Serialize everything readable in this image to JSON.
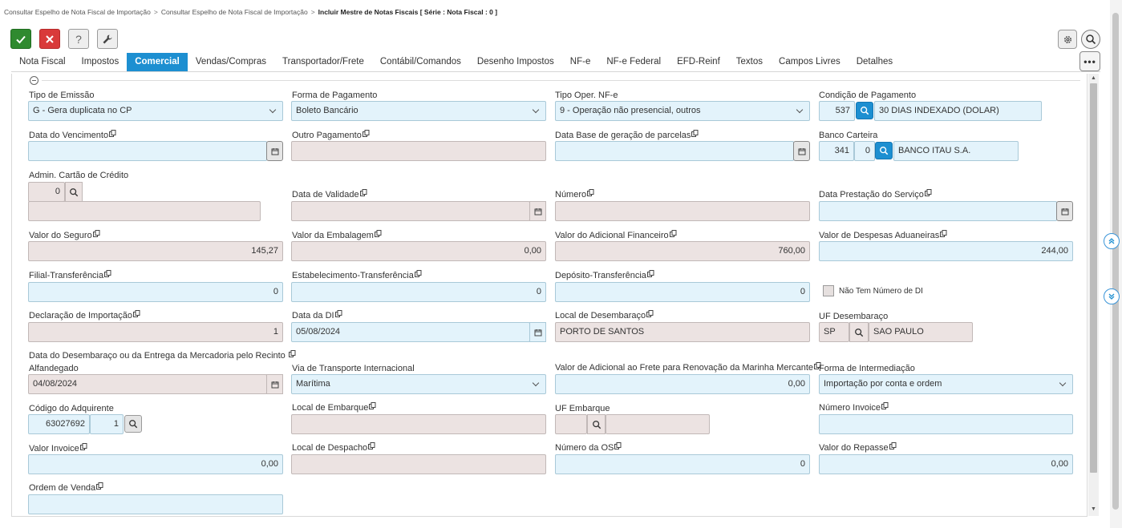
{
  "breadcrumb": {
    "item1": "Consultar Espelho de Nota Fiscal de Importação",
    "sep": ">",
    "item2": "Consultar Espelho de Nota Fiscal de Importação",
    "current": "Incluir Mestre de Notas Fiscais [ Série : Nota Fiscal : 0 ]"
  },
  "toolbar": {
    "ok_icon": "check-icon",
    "cancel_icon": "close-icon",
    "help_label": "?",
    "tools_icon": "wrench-icon",
    "settings_icon": "gear-icon",
    "search_icon": "search-icon",
    "more_label": "•••"
  },
  "colors": {
    "accent": "#1d8fd1",
    "ok": "#2f8a2f",
    "cancel": "#d93a3a",
    "editable_field": "#e3f3fb",
    "readonly_field": "#ece3e2"
  },
  "tabs": [
    {
      "label": "Nota Fiscal"
    },
    {
      "label": "Impostos"
    },
    {
      "label": "Comercial",
      "active": true
    },
    {
      "label": "Vendas/Compras"
    },
    {
      "label": "Transportador/Frete"
    },
    {
      "label": "Contábil/Comandos"
    },
    {
      "label": "Desenho Impostos"
    },
    {
      "label": "NF-e"
    },
    {
      "label": "NF-e Federal"
    },
    {
      "label": "EFD-Reinf"
    },
    {
      "label": "Textos"
    },
    {
      "label": "Campos Livres"
    },
    {
      "label": "Detalhes"
    }
  ],
  "fields": {
    "tipo_emissao": {
      "label": "Tipo de Emissão",
      "value": "G - Gera duplicata no CP"
    },
    "forma_pagamento": {
      "label": "Forma de Pagamento",
      "value": "Boleto Bancário"
    },
    "tipo_oper_nfe": {
      "label": "Tipo Oper. NF-e",
      "value": "9 - Operação não presencial, outros"
    },
    "condicao_pagamento": {
      "label": "Condição de Pagamento",
      "code": "537",
      "desc": "30 DIAS INDEXADO (DOLAR)"
    },
    "data_vencimento": {
      "label": "Data do Vencimento",
      "value": ""
    },
    "outro_pagamento": {
      "label": "Outro Pagamento",
      "value": ""
    },
    "data_base_parcelas": {
      "label": "Data Base de geração de parcelas",
      "value": ""
    },
    "banco_carteira": {
      "label": "Banco Carteira",
      "code": "341",
      "code2": "0",
      "desc": "BANCO ITAU S.A."
    },
    "admin_cartao": {
      "label": "Admin. Cartão de Crédito",
      "code": "0",
      "desc": ""
    },
    "data_validade": {
      "label": "Data de Validade",
      "value": ""
    },
    "numero": {
      "label": "Número",
      "value": ""
    },
    "data_prestacao": {
      "label": "Data Prestação do Serviço",
      "value": ""
    },
    "valor_seguro": {
      "label": "Valor do Seguro",
      "value": "145,27"
    },
    "valor_embalagem": {
      "label": "Valor da Embalagem",
      "value": "0,00"
    },
    "valor_adicional_financeiro": {
      "label": "Valor do Adicional Financeiro",
      "value": "760,00"
    },
    "valor_despesas_aduaneiras": {
      "label": "Valor de Despesas Aduaneiras",
      "value": "244,00"
    },
    "filial_transferencia": {
      "label": "Filial-Transferência",
      "value": "0"
    },
    "estabelecimento_transferencia": {
      "label": "Estabelecimento-Transferência",
      "value": "0"
    },
    "deposito_transferencia": {
      "label": "Depósito-Transferência",
      "value": "0"
    },
    "nao_tem_numero_di": {
      "label": "Não Tem Número de DI",
      "checked": false
    },
    "declaracao_importacao": {
      "label": "Declaração de Importação",
      "value": "1"
    },
    "data_di": {
      "label": "Data da DI",
      "value": "05/08/2024"
    },
    "local_desembaraco": {
      "label": "Local de Desembaraço",
      "value": "PORTO DE SANTOS"
    },
    "uf_desembaraco": {
      "label": "UF Desembaraço",
      "code": "SP",
      "desc": "SAO PAULO"
    },
    "data_desembaraco": {
      "label_line1": "Data do Desembaraço ou da Entrega da Mercadoria pelo Recinto",
      "label_line2": "Alfandegado",
      "value": "04/08/2024"
    },
    "via_transporte": {
      "label": "Via de Transporte Internacional",
      "value": "Marítima"
    },
    "valor_afrmm": {
      "label": "Valor de Adicional ao Frete para Renovação da Marinha Mercante",
      "value": "0,00"
    },
    "forma_intermediacao": {
      "label": "Forma de Intermediação",
      "value": "Importação por conta e ordem"
    },
    "codigo_adquirente": {
      "label": "Código do Adquirente",
      "code": "63027692",
      "code2": "1"
    },
    "local_embarque": {
      "label": "Local de Embarque",
      "value": ""
    },
    "uf_embarque": {
      "label": "UF Embarque",
      "code": "",
      "desc": ""
    },
    "numero_invoice": {
      "label": "Número Invoice",
      "value": ""
    },
    "valor_invoice": {
      "label": "Valor Invoice",
      "value": "0,00"
    },
    "local_despacho": {
      "label": "Local de Despacho",
      "value": ""
    },
    "numero_os": {
      "label": "Número da OS",
      "value": "0"
    },
    "valor_repasse": {
      "label": "Valor do Repasse",
      "value": "0,00"
    },
    "ordem_venda": {
      "label": "Ordem de Venda",
      "value": ""
    }
  }
}
